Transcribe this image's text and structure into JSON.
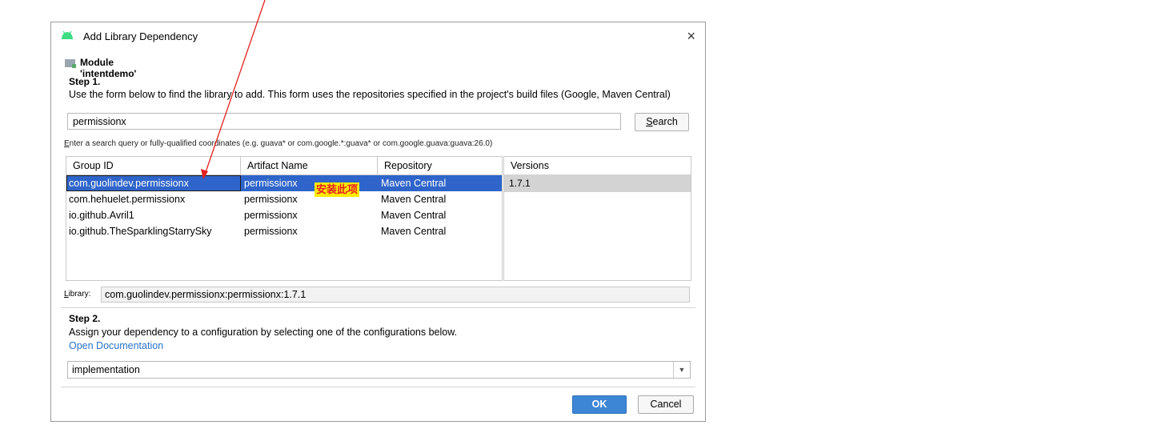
{
  "dialog": {
    "title": "Add Library Dependency",
    "close_glyph": "×",
    "module_label": "Module 'intentdemo'"
  },
  "step1": {
    "title": "Step 1.",
    "description": "Use the form below to find the library to add. This form uses the repositories specified in the project's build files (Google, Maven Central)",
    "search_value": "permissionx",
    "search_button_prefix": "S",
    "search_button_rest": "earch",
    "hint_prefix": "E",
    "hint_rest": "nter a search query or fully-qualified coordinates (e.g. guava* or com.google.*:guava* or com.google.guava:guava:26.0)"
  },
  "results": {
    "columns": [
      "Group ID",
      "Artifact Name",
      "Repository"
    ],
    "rows": [
      [
        "com.guolindev.permissionx",
        "permissionx",
        "Maven Central"
      ],
      [
        "com.hehuelet.permissionx",
        "permissionx",
        "Maven Central"
      ],
      [
        "io.github.Avril1",
        "permissionx",
        "Maven Central"
      ],
      [
        "io.github.TheSparklingStarrySky",
        "permissionx",
        "Maven Central"
      ]
    ],
    "selected_row_color": "#2f65ca"
  },
  "versions": {
    "header": "Versions",
    "items": [
      "1.7.1"
    ]
  },
  "annotation": {
    "text": "安装此项",
    "arrow_color": "#e32020"
  },
  "library": {
    "label_prefix": "L",
    "label_rest": "ibrary:",
    "value": "com.guolindev.permissionx:permissionx:1.7.1"
  },
  "step2": {
    "title": "Step 2.",
    "description": "Assign your dependency to a configuration by selecting one of the configurations below.",
    "docs_link": "Open Documentation",
    "config_value": "implementation"
  },
  "buttons": {
    "ok": "OK",
    "cancel": "Cancel"
  }
}
